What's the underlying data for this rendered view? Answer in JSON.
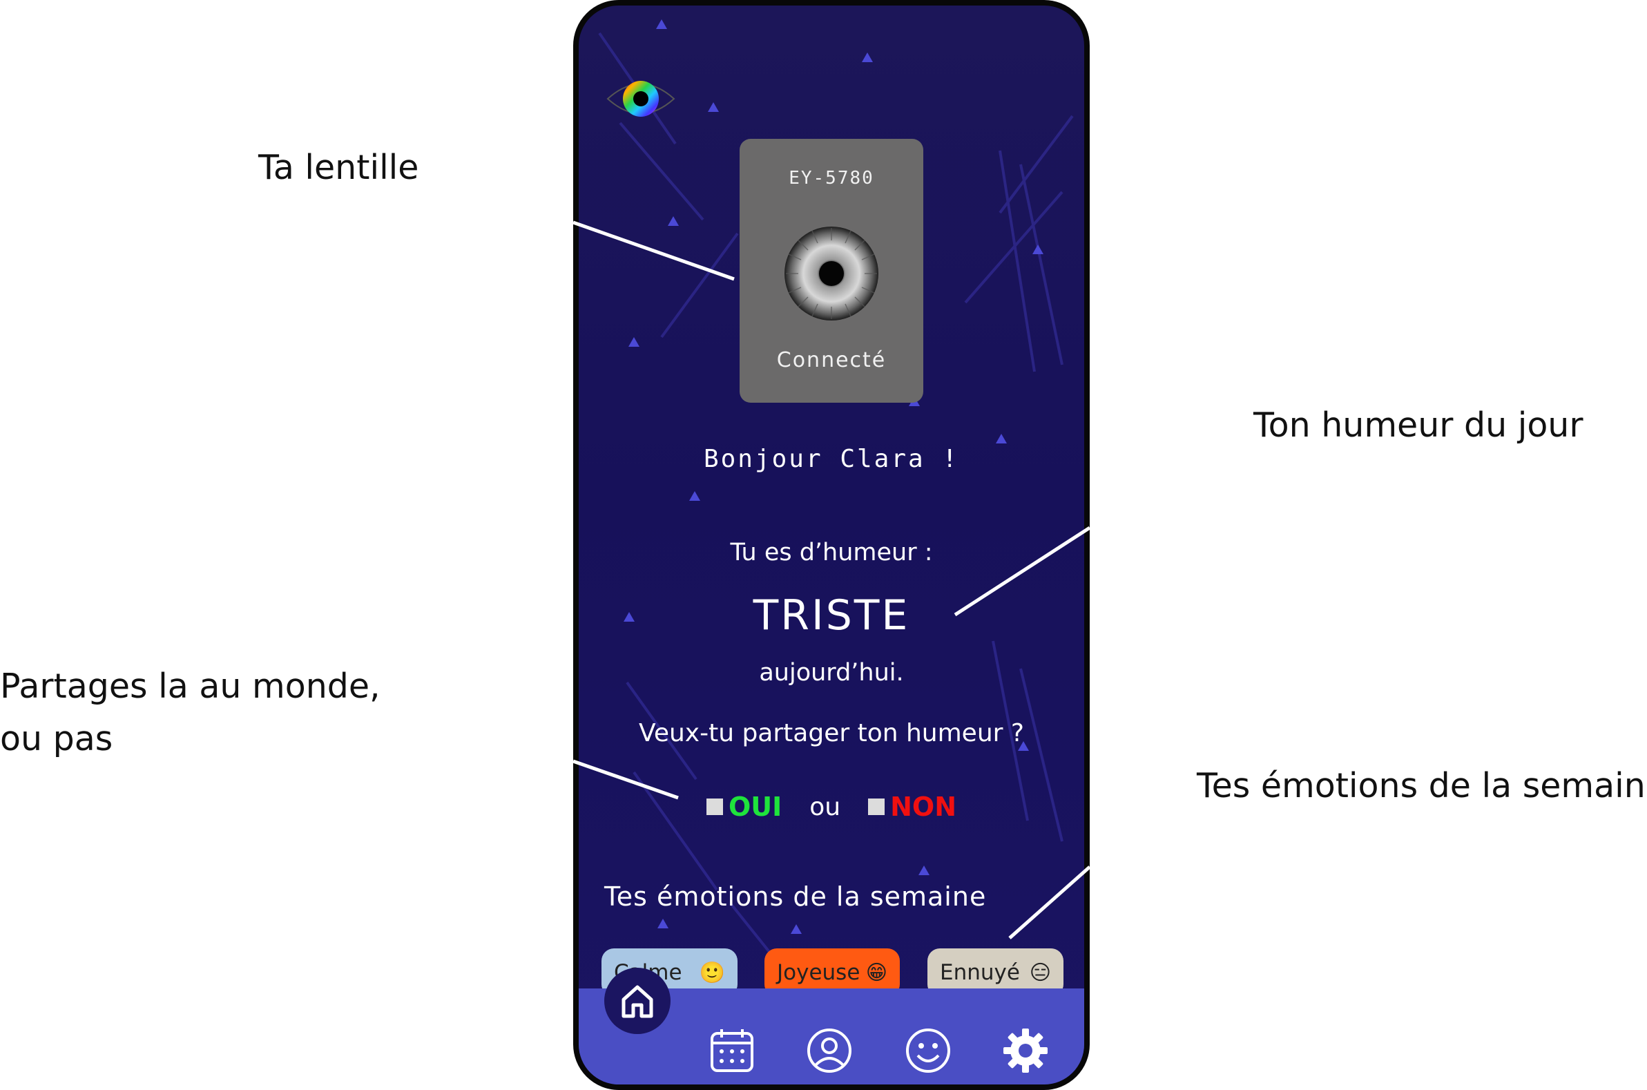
{
  "annotations": {
    "lens": "Ta lentille",
    "mood": "Ton humeur du jour",
    "share_line1": "Partages la au monde,",
    "share_line2": "ou pas",
    "week": "Tes émotions de la semaine"
  },
  "lens": {
    "id": "EY-5780",
    "status": "Connecté"
  },
  "greeting": "Bonjour Clara !",
  "mood": {
    "label": "Tu es d’humeur :",
    "value": "TRISTE",
    "suffix": "aujourd’hui."
  },
  "share": {
    "question": "Veux-tu partager ton humeur ?",
    "yes": "OUI",
    "or": "ou",
    "no": "NON"
  },
  "week": {
    "title": "Tes émotions de la semaine",
    "emotions": [
      {
        "label": "Calme",
        "emoji": "🙂",
        "color": "#a9c7e4"
      },
      {
        "label": "Joyeuse",
        "emoji": "😁",
        "color": "#ff5a12"
      },
      {
        "label": "Ennuyé",
        "emoji": "😑",
        "color": "#d5cfc1"
      }
    ]
  },
  "nav": {
    "items": [
      "home-icon",
      "calendar-icon",
      "profile-icon",
      "mood-icon",
      "settings-icon"
    ],
    "active": "home-icon",
    "bar_color": "#4a4ec4"
  }
}
